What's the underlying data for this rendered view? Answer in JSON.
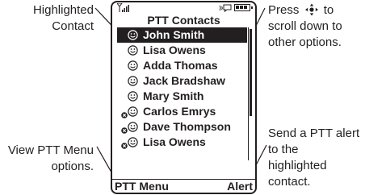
{
  "callouts": {
    "highlighted": [
      "Highlighted",
      "Contact"
    ],
    "press_prefix": "Press",
    "press_rest": [
      "to",
      "scroll down to",
      "other options."
    ],
    "view_menu": [
      "View PTT Menu",
      "options."
    ],
    "send_alert": [
      "Send a PTT alert",
      "to the",
      "highlighted",
      "contact."
    ]
  },
  "screen": {
    "title": "PTT Contacts",
    "contacts": [
      {
        "name": "John Smith",
        "selected": true,
        "unavailable": false
      },
      {
        "name": "Lisa Owens",
        "selected": false,
        "unavailable": false
      },
      {
        "name": "Adda Thomas",
        "selected": false,
        "unavailable": false
      },
      {
        "name": "Jack Bradshaw",
        "selected": false,
        "unavailable": false
      },
      {
        "name": "Mary Smith",
        "selected": false,
        "unavailable": false
      },
      {
        "name": "Carlos Emrys",
        "selected": false,
        "unavailable": true
      },
      {
        "name": "Dave Thompson",
        "selected": false,
        "unavailable": true
      },
      {
        "name": "Lisa Owens",
        "selected": false,
        "unavailable": true
      }
    ],
    "softkeys": {
      "left": "PTT Menu",
      "right": "Alert"
    },
    "icons": {
      "contact": "smiley-icon",
      "unavailable": "x-mark-icon",
      "nav": "nav-key-icon"
    }
  }
}
